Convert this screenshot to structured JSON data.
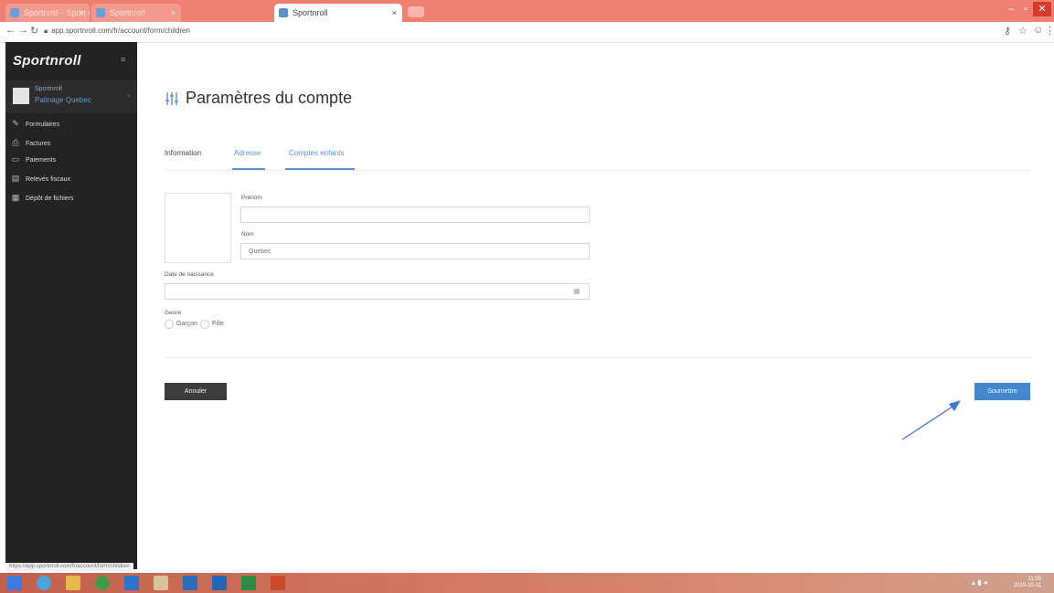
{
  "browser": {
    "tabs": [
      {
        "label": "Sportnroll - Sport Organizer"
      },
      {
        "label": "Sportnroll"
      },
      {
        "label": "Sportnroll"
      }
    ],
    "url": "app.sportnroll.com/fr/account/form/children",
    "colors": {
      "tabbar": "#ef7f70",
      "close": "#d63a2b"
    }
  },
  "sidebar": {
    "logo": "Sportnroll",
    "user": {
      "line1": "Sportnroll",
      "line2": "Patinage Quebec"
    },
    "items": [
      {
        "label": "Formulaires",
        "icon": "form-icon"
      },
      {
        "label": "Factures",
        "icon": "invoice-icon"
      },
      {
        "label": "Paiements",
        "icon": "payment-icon"
      },
      {
        "label": "Relevés fiscaux",
        "icon": "tax-report-icon"
      },
      {
        "label": "Dépôt de fichiers",
        "icon": "file-upload-icon"
      }
    ]
  },
  "page": {
    "title": "Paramètres du compte",
    "tabs": [
      {
        "label": "Information"
      },
      {
        "label": "Adresse"
      },
      {
        "label": "Comptes enfants"
      }
    ]
  },
  "form": {
    "first_name": {
      "label": "Prénom",
      "value": ""
    },
    "last_name": {
      "label": "Nom",
      "value": "Quebec"
    },
    "birth_date": {
      "label": "Date de naissance",
      "value": ""
    },
    "gender": {
      "label": "Genre",
      "options": [
        "Garçon",
        "Fille"
      ]
    },
    "cancel_label": "Annuler",
    "submit_label": "Soumettre"
  },
  "status_bar": "https://app.sportnroll.com/fr/account/form/children",
  "taskbar": {
    "time": "11:05",
    "date": "2019-10-11"
  },
  "accent_color": "#4488cb"
}
